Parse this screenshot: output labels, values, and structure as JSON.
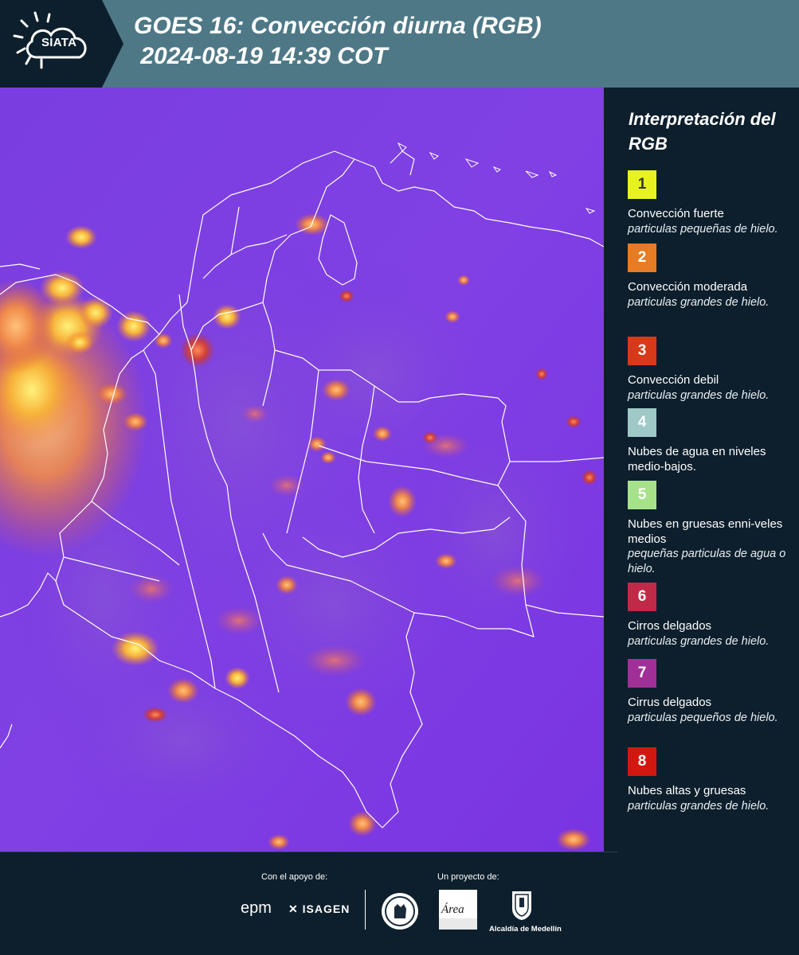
{
  "header": {
    "logo_text": "SIATA",
    "title_line1": "GOES 16: Convección diurna (RGB)",
    "title_line2": " 2024-08-19 14:39 COT"
  },
  "legend": {
    "title": "Interpretación del RGB",
    "items": [
      {
        "number": "1",
        "color": "#e8f21e",
        "text_color": "#333333",
        "label": "Convección fuerte",
        "sub": "particulas pequeñas de hielo."
      },
      {
        "number": "2",
        "color": "#e67c24",
        "text_color": "#ffffff",
        "label": "Convección moderada",
        "sub": "particulas grandes de hielo."
      },
      {
        "number": "3",
        "color": "#d63a18",
        "text_color": "#ffffff",
        "label": "Convección debil",
        "sub": "particulas grandes de hielo."
      },
      {
        "number": "4",
        "color": "#9ec9c6",
        "text_color": "#ffffff",
        "label": "Nubes de agua en niveles medio-bajos.",
        "sub": ""
      },
      {
        "number": "5",
        "color": "#a6e28a",
        "text_color": "#ffffff",
        "label": "Nubes en gruesas enni-veles medios",
        "sub": "pequeñas particulas de agua o hielo."
      },
      {
        "number": "6",
        "color": "#c02a48",
        "text_color": "#ffffff",
        "label": "Cirros delgados",
        "sub": "particulas grandes de hielo."
      },
      {
        "number": "7",
        "color": "#a22f98",
        "text_color": "#ffffff",
        "label": "Cirrus delgados",
        "sub": "particulas pequeños de hielo."
      },
      {
        "number": "8",
        "color": "#d2180e",
        "text_color": "#ffffff",
        "label": "Nubes altas y gruesas",
        "sub": "particulas grandes de hielo."
      }
    ]
  },
  "footer": {
    "support_label": "Con el apoyo de:",
    "project_label": "Un proyecto de:",
    "sponsor1": "epm",
    "sponsor2": "ISAGEN",
    "partner_area": "Área",
    "partner_alcaldia": "Alcaldía de Medellín"
  },
  "colors": {
    "header_bg": "#4e7886",
    "panel_bg": "#0d1f2c",
    "map_base": "#7a2fe0"
  }
}
